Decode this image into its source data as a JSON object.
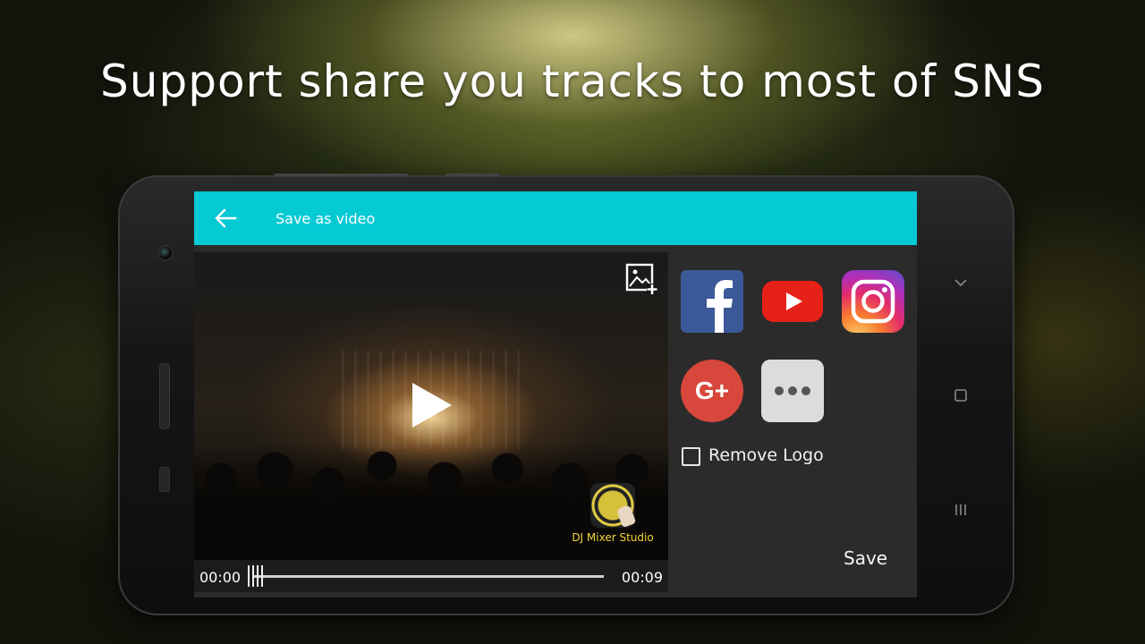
{
  "headline": "Support share you tracks to most of SNS",
  "appbar": {
    "title": "Save as video",
    "back_icon": "arrow-left-icon",
    "color": "#05c9d3"
  },
  "video": {
    "add_image_icon": "add-image-icon",
    "play_icon": "play-icon",
    "watermark_label": "DJ Mixer Studio",
    "time_current": "00:00",
    "time_total": "00:09",
    "progress": 0
  },
  "share": {
    "targets": [
      {
        "name": "facebook-icon",
        "color": "#3b5998"
      },
      {
        "name": "youtube-icon",
        "color": "#e62117"
      },
      {
        "name": "instagram-icon",
        "color": "#e32b6b"
      },
      {
        "name": "google-plus-icon",
        "color": "#d8473b"
      },
      {
        "name": "more-options-icon",
        "color": "#dcdcdc"
      }
    ],
    "remove_logo_label": "Remove Logo",
    "remove_logo_checked": false,
    "save_label": "Save"
  },
  "google_plus_text": "G+"
}
